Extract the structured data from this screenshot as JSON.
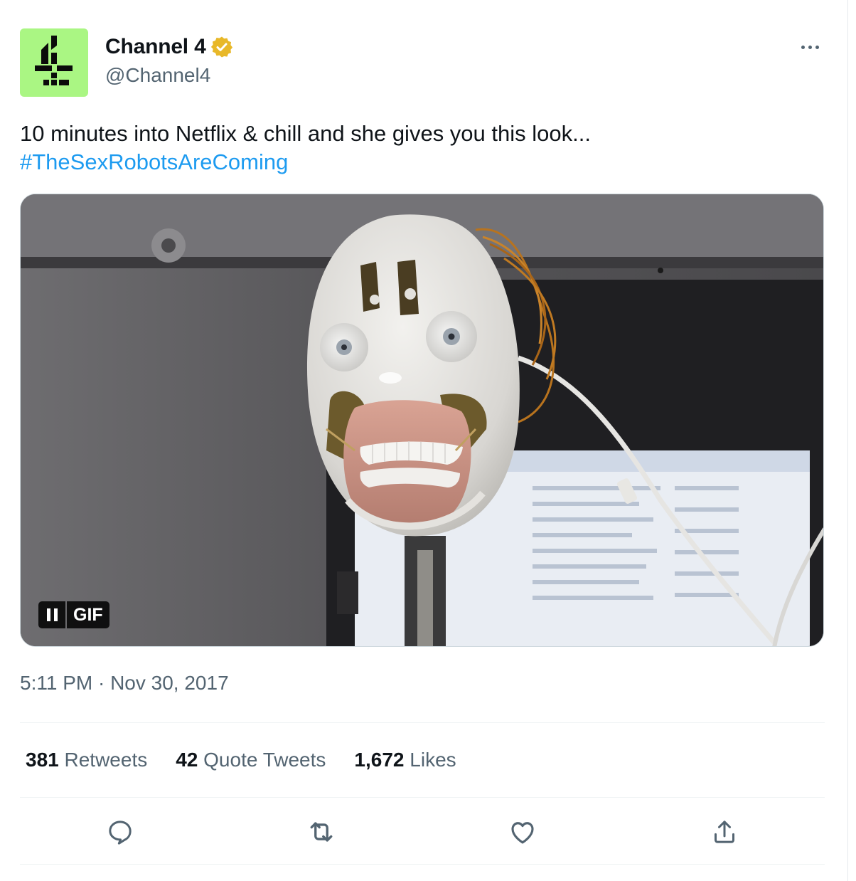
{
  "tweet": {
    "author": {
      "display_name": "Channel 4",
      "handle": "@Channel4",
      "verified": true,
      "avatar_icon": "channel4-logo",
      "avatar_color": "#aaf683"
    },
    "text_line": "10 minutes into Netflix & chill and she gives you this look...",
    "hashtag": "#TheSexRobotsAreComing",
    "media": {
      "type": "GIF",
      "badge_label": "GIF",
      "description_icon": "robot-head-photo"
    },
    "timestamp": "5:11 PM · Nov 30, 2017",
    "stats": {
      "retweets_count": "381",
      "retweets_label": "Retweets",
      "quotes_count": "42",
      "quotes_label": "Quote Tweets",
      "likes_count": "1,672",
      "likes_label": "Likes"
    },
    "actions": [
      "reply-icon",
      "retweet-icon",
      "like-icon",
      "share-icon"
    ],
    "colors": {
      "link": "#1d9bf0",
      "secondary_text": "#536471",
      "verified_badge": "#e8b829"
    }
  }
}
